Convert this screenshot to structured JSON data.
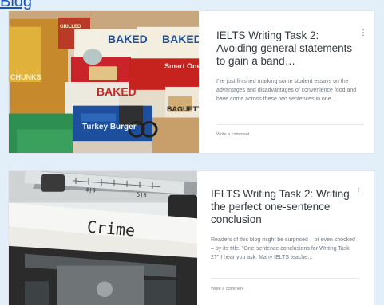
{
  "header": {
    "link_text": "Blog"
  },
  "posts": [
    {
      "title": "IELTS Writing Task 2: Avoiding general statements to gain a band…",
      "excerpt": "I've just finished marking some student essays on the advantages and disadvantages of convenience food and have come across these two sentences in one…",
      "comment_label": "Write a comment",
      "more_icon": "⋮",
      "image": {
        "description_icon": "convenience-food-photo",
        "package_texts": [
          "Healthy Choice",
          "BAKED",
          "BAKED",
          "Smart Ones",
          "BAKED",
          "Turkey Burger",
          "BAGUETTE",
          "GRILLED",
          "CHUNKS"
        ]
      }
    },
    {
      "title": "IELTS Writing Task 2: Writing the perfect one-sentence conclusion",
      "excerpt": "Readers of this blog might be surprised – or even shocked – by its title. \"One-sentence conclusions for Writing Task 2?\" I hear you ask. Many IELTS teache…",
      "comment_label": "Write a comment",
      "more_icon": "⋮",
      "image": {
        "description_icon": "typewriter-photo",
        "typed_word": "Crime",
        "scale_marks": [
          "4|0",
          "5|0"
        ]
      }
    }
  ],
  "colors": {
    "background": "#e3eff8",
    "link": "#1b56b6",
    "title": "#333a40",
    "excerpt": "#6e7880"
  }
}
